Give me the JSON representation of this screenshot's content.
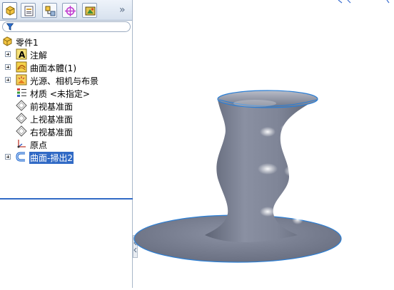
{
  "feature_tree": {
    "root": {
      "label": "零件1",
      "icon": "part-icon"
    },
    "items": [
      {
        "label": "注解",
        "icon": "annotations-icon",
        "expandable": true
      },
      {
        "label": "曲面本體(1)",
        "icon": "surface-bodies-icon",
        "expandable": true
      },
      {
        "label": "光源、相机与布景",
        "icon": "lights-cameras-scene-icon",
        "expandable": true
      },
      {
        "label": "材质 <未指定>",
        "icon": "material-icon",
        "expandable": false
      },
      {
        "label": "前视基准面",
        "icon": "plane-icon",
        "expandable": false
      },
      {
        "label": "上视基准面",
        "icon": "plane-icon",
        "expandable": false
      },
      {
        "label": "右视基准面",
        "icon": "plane-icon",
        "expandable": false
      },
      {
        "label": "原点",
        "icon": "origin-icon",
        "expandable": false
      },
      {
        "label": "曲面-掃出2",
        "icon": "surface-sweep-icon",
        "expandable": true,
        "selected": true
      }
    ]
  },
  "tabs": [
    {
      "name": "featuremanager-tab",
      "icon": "feature-tree-icon",
      "active": true
    },
    {
      "name": "propertymanager-tab",
      "icon": "property-manager-icon",
      "active": false
    },
    {
      "name": "configurationmanager-tab",
      "icon": "configuration-manager-icon",
      "active": false
    },
    {
      "name": "dimxpert-tab",
      "icon": "dimxpert-icon",
      "active": false
    },
    {
      "name": "display-manager-tab",
      "icon": "display-manager-icon",
      "active": false
    }
  ],
  "tab_overflow": "»",
  "filter": {
    "icon": "filter-icon"
  },
  "colors": {
    "selection": "#316ac5",
    "surface": "#7a8296",
    "edge": "#2b7fd6"
  }
}
